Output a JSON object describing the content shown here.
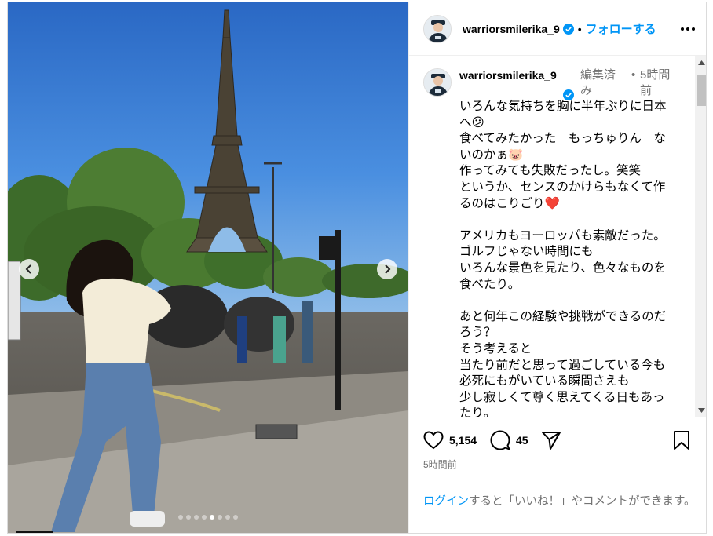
{
  "post": {
    "username": "warriorsmilerika_9",
    "follow_label": "フォローする",
    "separator": "•",
    "edited_label": "編集済み",
    "time_short": "5時間前",
    "time_long": "5時間前",
    "likes": "5,154",
    "comments": "45",
    "caption": "いろんな気持ちを胸に半年ぶりに日本へ😕\n食べてみたかった　もっちゅりん　ないのかぁ🐷\n作ってみても失敗だったし。笑笑\nというか、センスのかけらもなくて作るのはこりごり❤️\n\nアメリカもヨーロッパも素敵だった。\nゴルフじゃない時間にも\nいろんな景色を見たり、色々なものを食べたり。\n\nあと何年この経験や挑戦ができるのだろう？\nそう考えると\n当たり前だと思って過ごしている今も\n必死にもがいている瞬間さえも\n少し寂しくて尊く思えてくる日もあったり。"
  },
  "login_prompt": {
    "link": "ログイン",
    "rest": "すると「いいね！」やコメントができます。"
  },
  "carousel": {
    "total": 8,
    "active_index": 4
  },
  "icons": {
    "header_menu": "more-horizontal-icon",
    "verified": "verified-badge-icon",
    "like": "heart-icon",
    "comment": "comment-bubble-icon",
    "share": "paper-plane-icon",
    "save": "bookmark-icon"
  },
  "colors": {
    "link": "#0095f6",
    "muted": "#737373",
    "verified": "#0095f6"
  }
}
